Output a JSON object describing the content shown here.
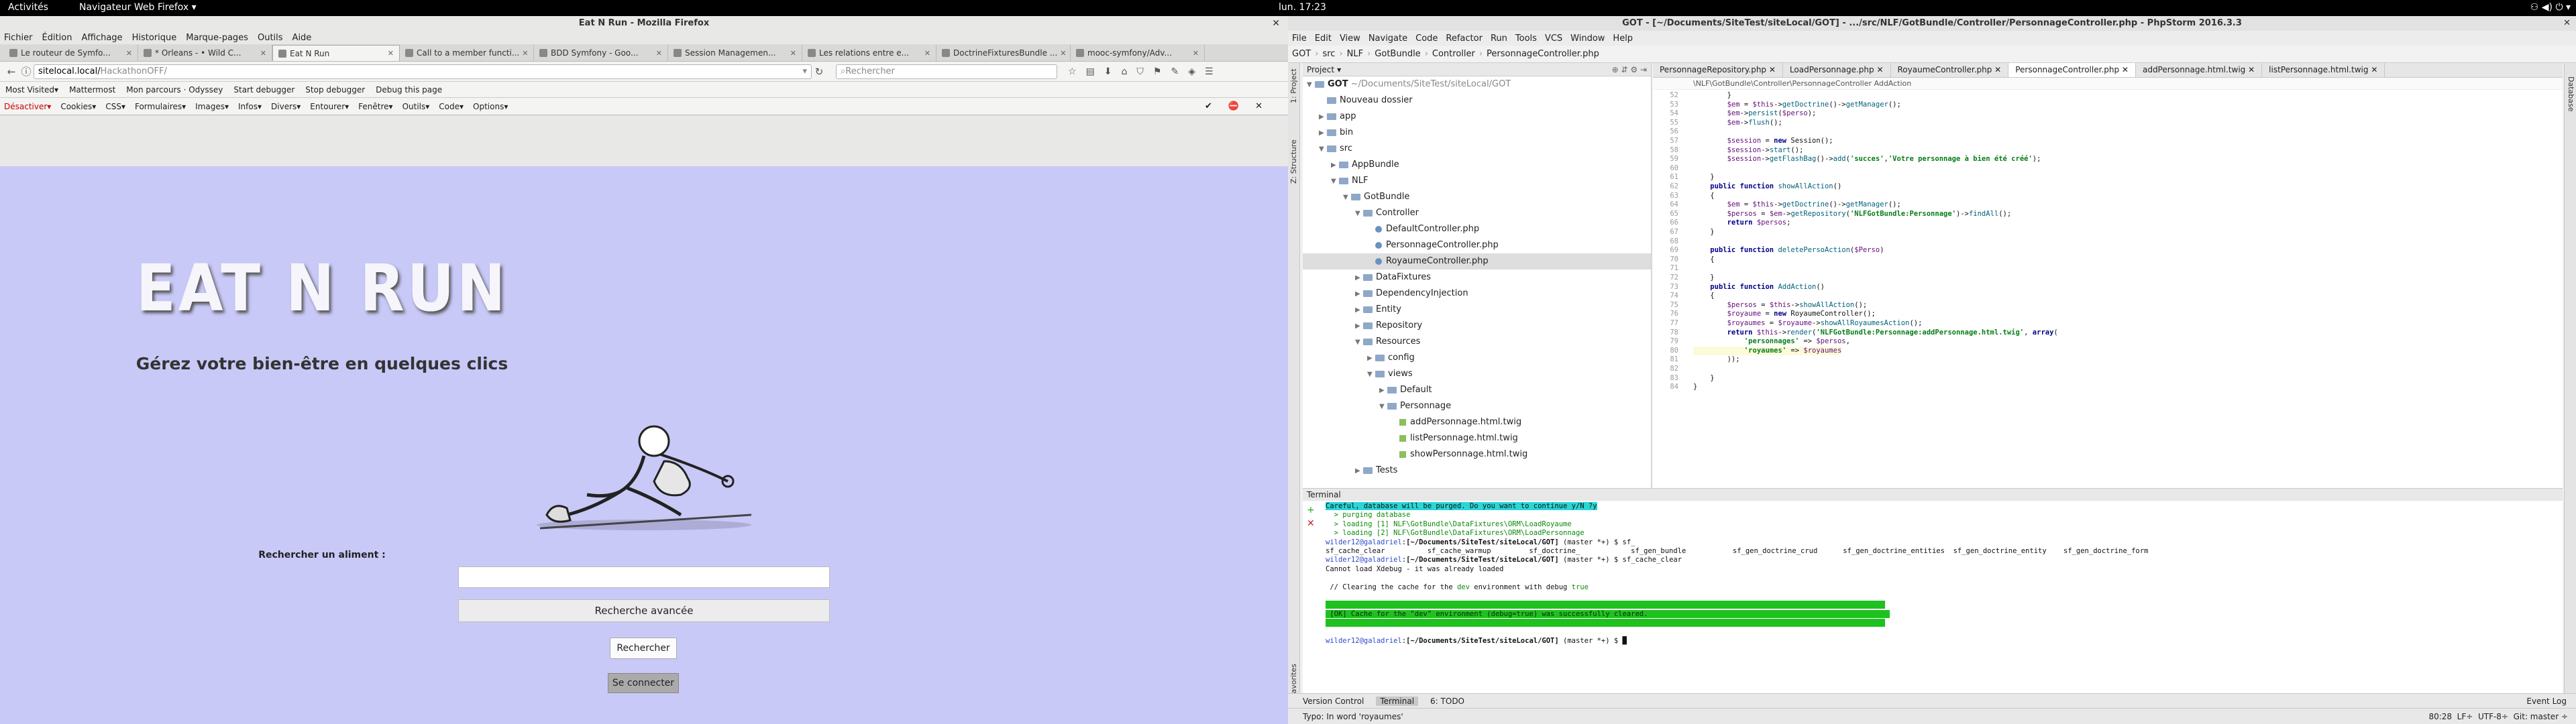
{
  "gnome": {
    "activities": "Activités",
    "app": "Navigateur Web Firefox",
    "clock": "lun. 17:23"
  },
  "firefox": {
    "title": "Eat N Run - Mozilla Firefox",
    "menu": [
      "Fichier",
      "Édition",
      "Affichage",
      "Historique",
      "Marque-pages",
      "Outils",
      "Aide"
    ],
    "tabs": [
      {
        "label": "Le routeur de Symfo...",
        "active": false
      },
      {
        "label": "* Orleans - • Wild C...",
        "active": false
      },
      {
        "label": "Eat N Run",
        "active": true
      },
      {
        "label": "Call to a member functi...",
        "active": false
      },
      {
        "label": "BDD Symfony - Goo...",
        "active": false
      },
      {
        "label": "Session Managemen...",
        "active": false
      },
      {
        "label": "Les relations entre e...",
        "active": false
      },
      {
        "label": "DoctrineFixturesBundle ...",
        "active": false
      },
      {
        "label": "mooc-symfony/Adv...",
        "active": false
      }
    ],
    "url_host": "sitelocal.local/",
    "url_path": "HackathonOFF/",
    "search_placeholder": "Rechercher",
    "bookmarks": [
      "Most Visited▾",
      "Mattermost",
      "Mon parcours · Odyssey",
      "Start debugger",
      "Stop debugger",
      "Debug this page"
    ],
    "devbar": [
      "Désactiver▾",
      "Cookies▾",
      "CSS▾",
      "Formulaires▾",
      "Images▾",
      "Infos▾",
      "Divers▾",
      "Entourer▾",
      "Fenêtre▾",
      "Outils▾",
      "Code▾",
      "Options▾"
    ]
  },
  "page": {
    "brand": "EAT N RUN",
    "tagline": "Gérez votre bien-être en quelques clics",
    "search_label": "Rechercher un aliment :",
    "advanced": "Recherche avancée",
    "submit": "Rechercher",
    "login": "Se connecter"
  },
  "ide": {
    "title": "GOT - [~/Documents/SiteTest/siteLocal/GOT] - .../src/NLF/GotBundle/Controller/PersonnageController.php - PhpStorm 2016.3.3",
    "menu": [
      "File",
      "Edit",
      "View",
      "Navigate",
      "Code",
      "Refactor",
      "Run",
      "Tools",
      "VCS",
      "Window",
      "Help"
    ],
    "breadcrumb": [
      "GOT",
      "src",
      "NLF",
      "GotBundle",
      "Controller",
      "PersonnageController.php"
    ],
    "project_label": "Project",
    "tree": [
      {
        "d": 0,
        "t": "GOT",
        "k": "root",
        "extra": "~/Documents/SiteTest/siteLocal/GOT",
        "open": true
      },
      {
        "d": 1,
        "t": "Nouveau dossier",
        "k": "folder"
      },
      {
        "d": 1,
        "t": "app",
        "k": "folder",
        "closed": true
      },
      {
        "d": 1,
        "t": "bin",
        "k": "folder",
        "closed": true
      },
      {
        "d": 1,
        "t": "src",
        "k": "folder",
        "open": true
      },
      {
        "d": 2,
        "t": "AppBundle",
        "k": "folder",
        "closed": true
      },
      {
        "d": 2,
        "t": "NLF",
        "k": "folder",
        "open": true
      },
      {
        "d": 3,
        "t": "GotBundle",
        "k": "folder",
        "open": true
      },
      {
        "d": 4,
        "t": "Controller",
        "k": "folder",
        "open": true
      },
      {
        "d": 5,
        "t": "DefaultController.php",
        "k": "php"
      },
      {
        "d": 5,
        "t": "PersonnageController.php",
        "k": "php"
      },
      {
        "d": 5,
        "t": "RoyaumeController.php",
        "k": "php",
        "sel": true
      },
      {
        "d": 4,
        "t": "DataFixtures",
        "k": "folder",
        "closed": true
      },
      {
        "d": 4,
        "t": "DependencyInjection",
        "k": "folder",
        "closed": true
      },
      {
        "d": 4,
        "t": "Entity",
        "k": "folder",
        "closed": true
      },
      {
        "d": 4,
        "t": "Repository",
        "k": "folder",
        "closed": true
      },
      {
        "d": 4,
        "t": "Resources",
        "k": "folder",
        "open": true
      },
      {
        "d": 5,
        "t": "config",
        "k": "folder",
        "closed": true
      },
      {
        "d": 5,
        "t": "views",
        "k": "folder",
        "open": true
      },
      {
        "d": 6,
        "t": "Default",
        "k": "folder",
        "closed": true
      },
      {
        "d": 6,
        "t": "Personnage",
        "k": "folder",
        "open": true
      },
      {
        "d": 7,
        "t": "addPersonnage.html.twig",
        "k": "twig"
      },
      {
        "d": 7,
        "t": "listPersonnage.html.twig",
        "k": "twig"
      },
      {
        "d": 7,
        "t": "showPersonnage.html.twig",
        "k": "twig"
      },
      {
        "d": 4,
        "t": "Tests",
        "k": "folder",
        "closed": true
      }
    ],
    "editor_tabs": [
      {
        "label": "PersonnageRepository.php",
        "active": false
      },
      {
        "label": "LoadPersonnage.php",
        "active": false
      },
      {
        "label": "RoyaumeController.php",
        "active": false
      },
      {
        "label": "PersonnageController.php",
        "active": true
      },
      {
        "label": "addPersonnage.html.twig",
        "active": false
      },
      {
        "label": "listPersonnage.html.twig",
        "active": false
      }
    ],
    "code_crumb": "\\NLF\\GotBundle\\Controller\\PersonnageController  AddAction",
    "code": [
      {
        "n": "52",
        "h": "        }"
      },
      {
        "n": "53",
        "h": "        <span class=vr>$em</span> = <span class=vr>$this</span>-><span class=fn>getDoctrine</span>()-><span class=fn>getManager</span>();"
      },
      {
        "n": "54",
        "h": "        <span class=vr>$em</span>-><span class=fn>persist</span>(<span class=vr>$perso</span>);"
      },
      {
        "n": "55",
        "h": "        <span class=vr>$em</span>-><span class=fn>flush</span>();"
      },
      {
        "n": "56",
        "h": ""
      },
      {
        "n": "57",
        "h": "        <span class=vr>$session</span> = <span class=kw>new</span> Session();"
      },
      {
        "n": "58",
        "h": "        <span class=vr>$session</span>-><span class=fn>start</span>();"
      },
      {
        "n": "59",
        "h": "        <span class=vr>$session</span>-><span class=fn>getFlashBag</span>()-><span class=fn>add</span>(<span class=st>'succes'</span>,<span class=st>'Votre personnage à bien été créé'</span>);"
      },
      {
        "n": "60",
        "h": ""
      },
      {
        "n": "61",
        "h": "    }"
      },
      {
        "n": "62",
        "h": "    <span class=kw>public function</span> <span class=fn>showAllAction</span>()"
      },
      {
        "n": "63",
        "h": "    {"
      },
      {
        "n": "64",
        "h": "        <span class=vr>$em</span> = <span class=vr>$this</span>-><span class=fn>getDoctrine</span>()-><span class=fn>getManager</span>();"
      },
      {
        "n": "65",
        "h": "        <span class=vr>$persos</span> = <span class=vr>$em</span>-><span class=fn>getRepository</span>(<span class=st>'NLFGotBundle:Personnage'</span>)-><span class=fn>findAll</span>();"
      },
      {
        "n": "66",
        "h": "        <span class=kw>return</span> <span class=vr>$persos</span>;"
      },
      {
        "n": "67",
        "h": "    }"
      },
      {
        "n": "68",
        "h": ""
      },
      {
        "n": "69",
        "h": "    <span class=kw>public function</span> <span class=fn>deletePersoAction</span>(<span class=vr>$Perso</span>)"
      },
      {
        "n": "70",
        "h": "    {"
      },
      {
        "n": "71",
        "h": ""
      },
      {
        "n": "72",
        "h": "    }"
      },
      {
        "n": "73",
        "h": "    <span class=kw>public function</span> <span class=fn>AddAction</span>()"
      },
      {
        "n": "74",
        "h": "    {"
      },
      {
        "n": "75",
        "h": "        <span class=vr>$persos</span> = <span class=vr>$this</span>-><span class=fn>showAllAction</span>();"
      },
      {
        "n": "76",
        "h": "        <span class=vr>$royaume</span> = <span class=kw>new</span> RoyaumeController();"
      },
      {
        "n": "77",
        "h": "        <span class=vr>$royaumes</span> = <span class=vr>$royaume</span>-><span class=fn>showAllRoyaumesAction</span>();"
      },
      {
        "n": "78",
        "h": "        <span class=kw>return</span> <span class=vr>$this</span>-><span class=fn>render</span>(<span class=st>'NLFGotBundle:Personnage:addPersonnage.html.twig'</span>, <span class=kw>array</span>("
      },
      {
        "n": "79",
        "h": "            <span class=st>'personnages'</span> => <span class=vr>$persos</span>,"
      },
      {
        "n": "80",
        "h": "            <span class=st>'royaumes'</span> => <span class=vr>$royaumes</span>",
        "hl": true
      },
      {
        "n": "81",
        "h": "        ));"
      },
      {
        "n": "82",
        "h": ""
      },
      {
        "n": "83",
        "h": "    }"
      },
      {
        "n": "84",
        "h": "}"
      }
    ],
    "terminal_label": "Terminal",
    "terminal": [
      {
        "h": "<span class=warn>Careful, database will be purged. Do you want to continue y/N ?y</span>"
      },
      {
        "h": "  <span class=gr>&gt; purging database</span>"
      },
      {
        "h": "  <span class=gr>&gt; loading [1] NLF\\GotBundle\\DataFixtures\\ORM\\LoadRoyaume</span>"
      },
      {
        "h": "  <span class=gr>&gt; loading [2] NLF\\GotBundle\\DataFixtures\\ORM\\LoadPersonnage</span>"
      },
      {
        "h": "<span class=bl>wilder12@galadriel</span>:<b>[~/Documents/SiteTest/siteLocal/GOT]</b> (master *+) $ sf_"
      },
      {
        "h": "sf_cache_clear          sf_cache_warmup         sf_doctrine_            sf_gen_bundle           sf_gen_doctrine_crud      sf_gen_doctrine_entities  sf_gen_doctrine_entity    sf_gen_doctrine_form"
      },
      {
        "h": "<span class=bl>wilder12@galadriel</span>:<b>[~/Documents/SiteTest/siteLocal/GOT]</b> (master *+) $ sf_cache_clear"
      },
      {
        "h": "Cannot load Xdebug - it was already loaded"
      },
      {
        "h": ""
      },
      {
        "h": " // Clearing the cache for the <span class=gr>dev</span> environment with debug <span class=gr>true</span>"
      },
      {
        "h": ""
      },
      {
        "h": "<span class=ok>                                                                                                                                    </span>"
      },
      {
        "h": "<span class=ok> [OK] Cache for the \"dev\" environment (debug=true) was successfully cleared.                                                         </span>"
      },
      {
        "h": "<span class=ok>                                                                                                                                    </span>"
      },
      {
        "h": ""
      },
      {
        "h": "<span class=bl>wilder12@galadriel</span>:<b>[~/Documents/SiteTest/siteLocal/GOT]</b> (master *+) $ █"
      }
    ],
    "toolwins": [
      "Version Control",
      "Terminal",
      "6: TODO"
    ],
    "eventlog": "Event Log",
    "status": "Typo: In word 'royaumes'",
    "status_right": "80:28  LF÷  UTF-8÷  Git: master ÷"
  }
}
